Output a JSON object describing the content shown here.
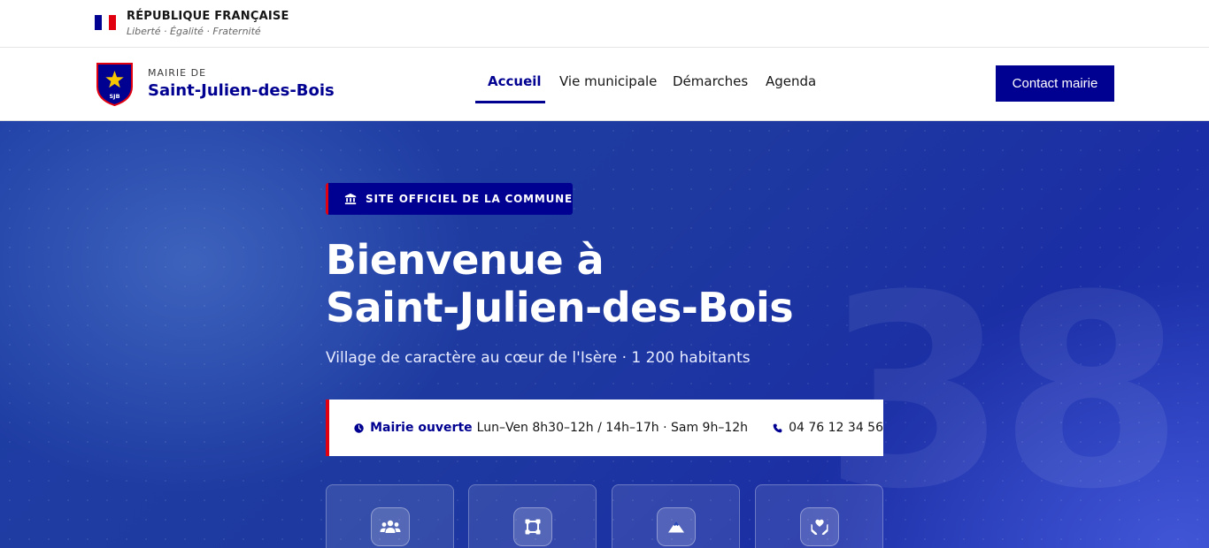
{
  "gov": {
    "title": "RÉPUBLIQUE FRANÇAISE",
    "motto": "Liberté · Égalité · Fraternité"
  },
  "header": {
    "brand_small": "MAIRIE DE",
    "brand_name": "Saint-Julien-des-Bois",
    "logo_text": "SJB",
    "nav": [
      {
        "label": "Accueil",
        "active": true
      },
      {
        "label": "Vie municipale",
        "active": false
      },
      {
        "label": "Démarches",
        "active": false
      },
      {
        "label": "Agenda",
        "active": false
      }
    ],
    "contact_button": "Contact mairie"
  },
  "hero": {
    "badge": "SITE OFFICIEL DE LA COMMUNE",
    "title_line1": "Bienvenue à",
    "title_line2": "Saint-Julien-des-Bois",
    "subtitle": "Village de caractère au cœur de l'Isère · 1 200 habitants",
    "background_number": "38",
    "info": {
      "status": "Mairie ouverte",
      "hours": "Lun–Ven 8h30–12h / 14h–17h · Sam 9h–12h",
      "phone": "04 76 12 34 56"
    },
    "tiles": [
      {
        "icon": "users-icon"
      },
      {
        "icon": "vector-square-icon"
      },
      {
        "icon": "mountain-icon"
      },
      {
        "icon": "hands-holding-heart-icon"
      }
    ]
  },
  "colors": {
    "primary": "#000091",
    "accent_red": "#e1000f",
    "hero_blue": "#1e3aa0"
  }
}
